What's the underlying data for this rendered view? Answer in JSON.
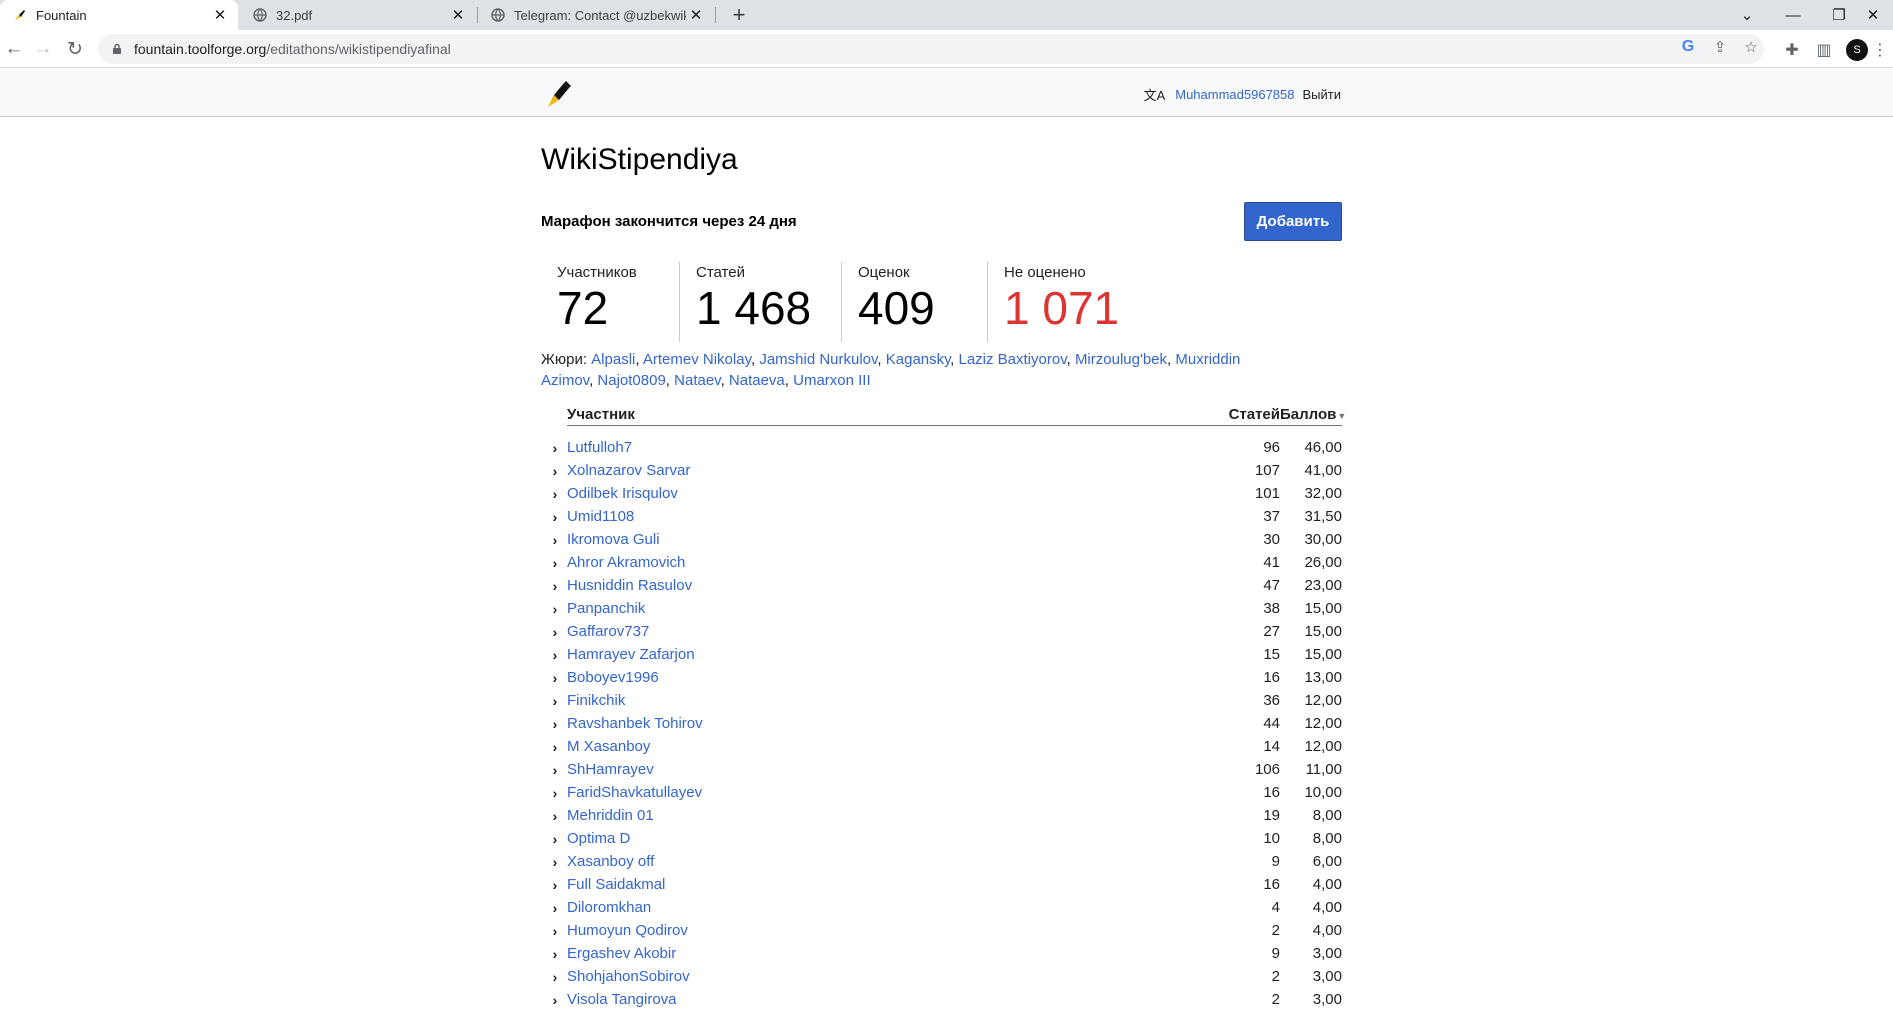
{
  "browser": {
    "tabs": [
      {
        "title": "Fountain",
        "icon": "fountain-pen-icon",
        "active": true
      },
      {
        "title": "32.pdf",
        "icon": "globe-icon",
        "active": false
      },
      {
        "title": "Telegram: Contact @uzbekwikipe",
        "icon": "globe-icon",
        "active": false
      }
    ],
    "url_host": "fountain.toolforge.org",
    "url_path": "/editathons/wikistipendiyafinal",
    "profile_initial": "S"
  },
  "header": {
    "username": "Muhammad5967858",
    "logout": "Выйти"
  },
  "page": {
    "title": "WikiStipendiya",
    "countdown": "Марафон закончится через 24 дня",
    "add_button": "Добавить"
  },
  "stats": {
    "participants_label": "Участников",
    "participants_value": "72",
    "articles_label": "Статей",
    "articles_value": "1 468",
    "ratings_label": "Оценок",
    "ratings_value": "409",
    "unrated_label": "Не оценено",
    "unrated_value": "1 071"
  },
  "jury": {
    "label": "Жюри:",
    "members": [
      "Alpasli",
      "Artemev Nikolay",
      "Jamshid Nurkulov",
      "Kaganskу",
      "Laziz Baxtiyorov",
      "Mirzoulug'bek",
      "Muxriddin Azimov",
      "Najot0809",
      "Nataev",
      "Nataeva",
      "Umarxon III"
    ]
  },
  "table": {
    "col_participant": "Участник",
    "col_articles": "Статей",
    "col_score": "Баллов",
    "rows": [
      {
        "name": "Lutfulloh7",
        "articles": "96",
        "score": "46,00"
      },
      {
        "name": "Xolnazarov Sarvar",
        "articles": "107",
        "score": "41,00"
      },
      {
        "name": "Odilbek Irisqulov",
        "articles": "101",
        "score": "32,00"
      },
      {
        "name": "Umid1108",
        "articles": "37",
        "score": "31,50"
      },
      {
        "name": "Ikromova Guli",
        "articles": "30",
        "score": "30,00"
      },
      {
        "name": "Ahror Akramovich",
        "articles": "41",
        "score": "26,00"
      },
      {
        "name": "Husniddin Rasulov",
        "articles": "47",
        "score": "23,00"
      },
      {
        "name": "Panpanchik",
        "articles": "38",
        "score": "15,00"
      },
      {
        "name": "Gaffarov737",
        "articles": "27",
        "score": "15,00"
      },
      {
        "name": "Hamrayev Zafarjon",
        "articles": "15",
        "score": "15,00"
      },
      {
        "name": "Boboyev1996",
        "articles": "16",
        "score": "13,00"
      },
      {
        "name": "Finikchik",
        "articles": "36",
        "score": "12,00"
      },
      {
        "name": "Ravshanbek Tohirov",
        "articles": "44",
        "score": "12,00"
      },
      {
        "name": "M Xasanboy",
        "articles": "14",
        "score": "12,00"
      },
      {
        "name": "ShHamrayev",
        "articles": "106",
        "score": "11,00"
      },
      {
        "name": "FaridShavkatullayev",
        "articles": "16",
        "score": "10,00"
      },
      {
        "name": "Mehriddin 01",
        "articles": "19",
        "score": "8,00"
      },
      {
        "name": "Optima D",
        "articles": "10",
        "score": "8,00"
      },
      {
        "name": "Xasanboy off",
        "articles": "9",
        "score": "6,00"
      },
      {
        "name": "Full Saidakmal",
        "articles": "16",
        "score": "4,00"
      },
      {
        "name": "Diloromkhan",
        "articles": "4",
        "score": "4,00"
      },
      {
        "name": "Humoyun Qodirov",
        "articles": "2",
        "score": "4,00"
      },
      {
        "name": "Ergashev Akobir",
        "articles": "9",
        "score": "3,00"
      },
      {
        "name": "ShohjahonSobirov",
        "articles": "2",
        "score": "3,00"
      },
      {
        "name": "Visola Tangirova",
        "articles": "2",
        "score": "3,00"
      }
    ]
  }
}
